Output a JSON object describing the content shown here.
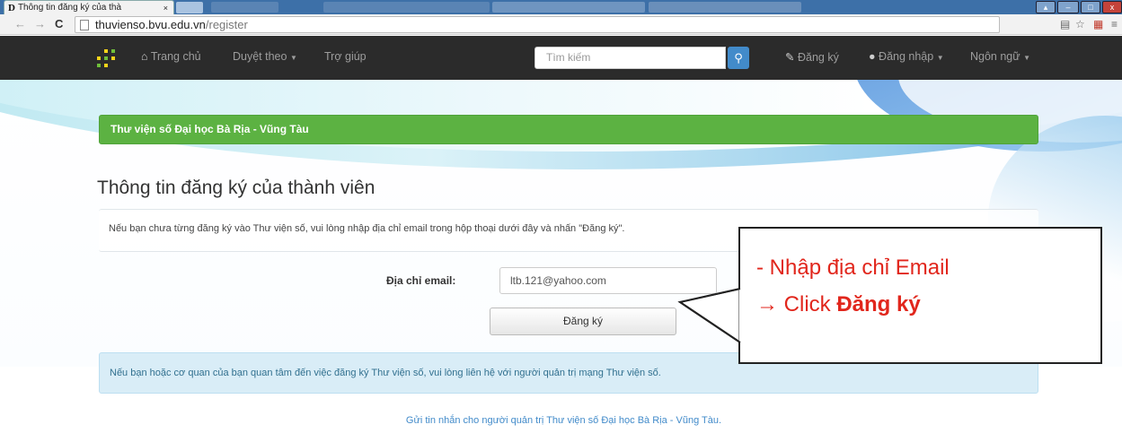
{
  "browser": {
    "tab_title": "Thông tin đăng ký của thà",
    "tab_favicon": "D",
    "tab_close": "×",
    "url_domain": "thuvienso.bvu.edu.vn",
    "url_path": "/register"
  },
  "navbar": {
    "home": "Trang chủ",
    "browse": "Duyệt theo",
    "help": "Trợ giúp",
    "search_placeholder": "Tìm kiếm",
    "register": "Đăng ký",
    "login": "Đăng nhập",
    "language": "Ngôn ngữ"
  },
  "banner": {
    "text": "Thư viện số Đại học Bà Rịa - Vũng Tàu"
  },
  "form": {
    "title": "Thông tin đăng ký của thành viên",
    "intro": "Nếu bạn chưa từng đăng ký vào Thư viện số, vui lòng nhập địa chỉ email trong hộp thoại dưới đây và nhấn \"Đăng ký\".",
    "email_label": "Địa chỉ email:",
    "email_value": "ltb.121@yahoo.com",
    "submit_label": "Đăng ký"
  },
  "info": {
    "text": "Nếu bạn hoặc cơ quan của bạn quan tâm đến việc đăng ký Thư viện số, vui lòng liên hệ với người quản trị mạng Thư viện số."
  },
  "footer": {
    "link": "Gửi tin nhắn cho người quản trị Thư viện số Đại học Bà Rịa - Vũng Tàu."
  },
  "callout": {
    "line1": "- Nhập địa chỉ Email",
    "line2_prefix": "→ Click ",
    "line2_bold": "Đăng ký"
  },
  "colors": {
    "navbar_bg": "#2b2b2b",
    "banner_green": "#5cb242",
    "search_button_blue": "#428bca",
    "callout_red": "#e1261c",
    "info_bg": "#d9edf7"
  },
  "icons": {
    "home": "home-icon",
    "search": "search-icon",
    "register": "pencil-icon",
    "login": "user-icon",
    "caret": "caret-down-icon"
  }
}
